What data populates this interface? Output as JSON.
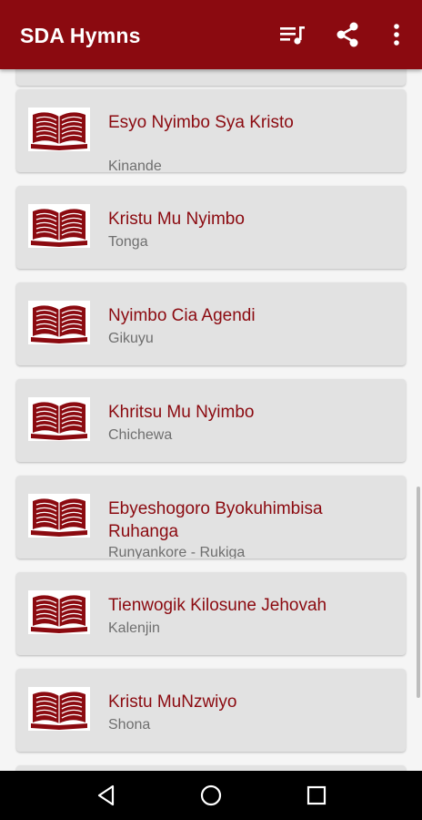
{
  "app": {
    "title": "SDA Hymns"
  },
  "toolbar": {
    "icons": [
      "playlist-icon",
      "share-icon",
      "more-vert-icon"
    ]
  },
  "hymnals": [
    {
      "name": "Esyo Nyimbo Sya Kristo",
      "language": "Kinande"
    },
    {
      "name": "Kristu Mu Nyimbo",
      "language": "Tonga"
    },
    {
      "name": "Nyimbo Cia Agendi",
      "language": "Gikuyu"
    },
    {
      "name": "Khritsu Mu Nyimbo",
      "language": "Chichewa"
    },
    {
      "name": "Ebyeshogoro Byokuhimbisa Ruhanga",
      "language": "Runyankore - Rukiga"
    },
    {
      "name": "Tienwogik Kilosune Jehovah",
      "language": "Kalenjin"
    },
    {
      "name": "Kristu MuNzwiyo",
      "language": "Shona"
    }
  ],
  "navigation": {
    "icons": [
      "back-icon",
      "home-icon",
      "recents-icon"
    ]
  },
  "colors": {
    "primary": "#8b0a10",
    "card": "#e2e2e2",
    "background": "#f5f5f5",
    "subtitle": "#6f6f6f"
  }
}
